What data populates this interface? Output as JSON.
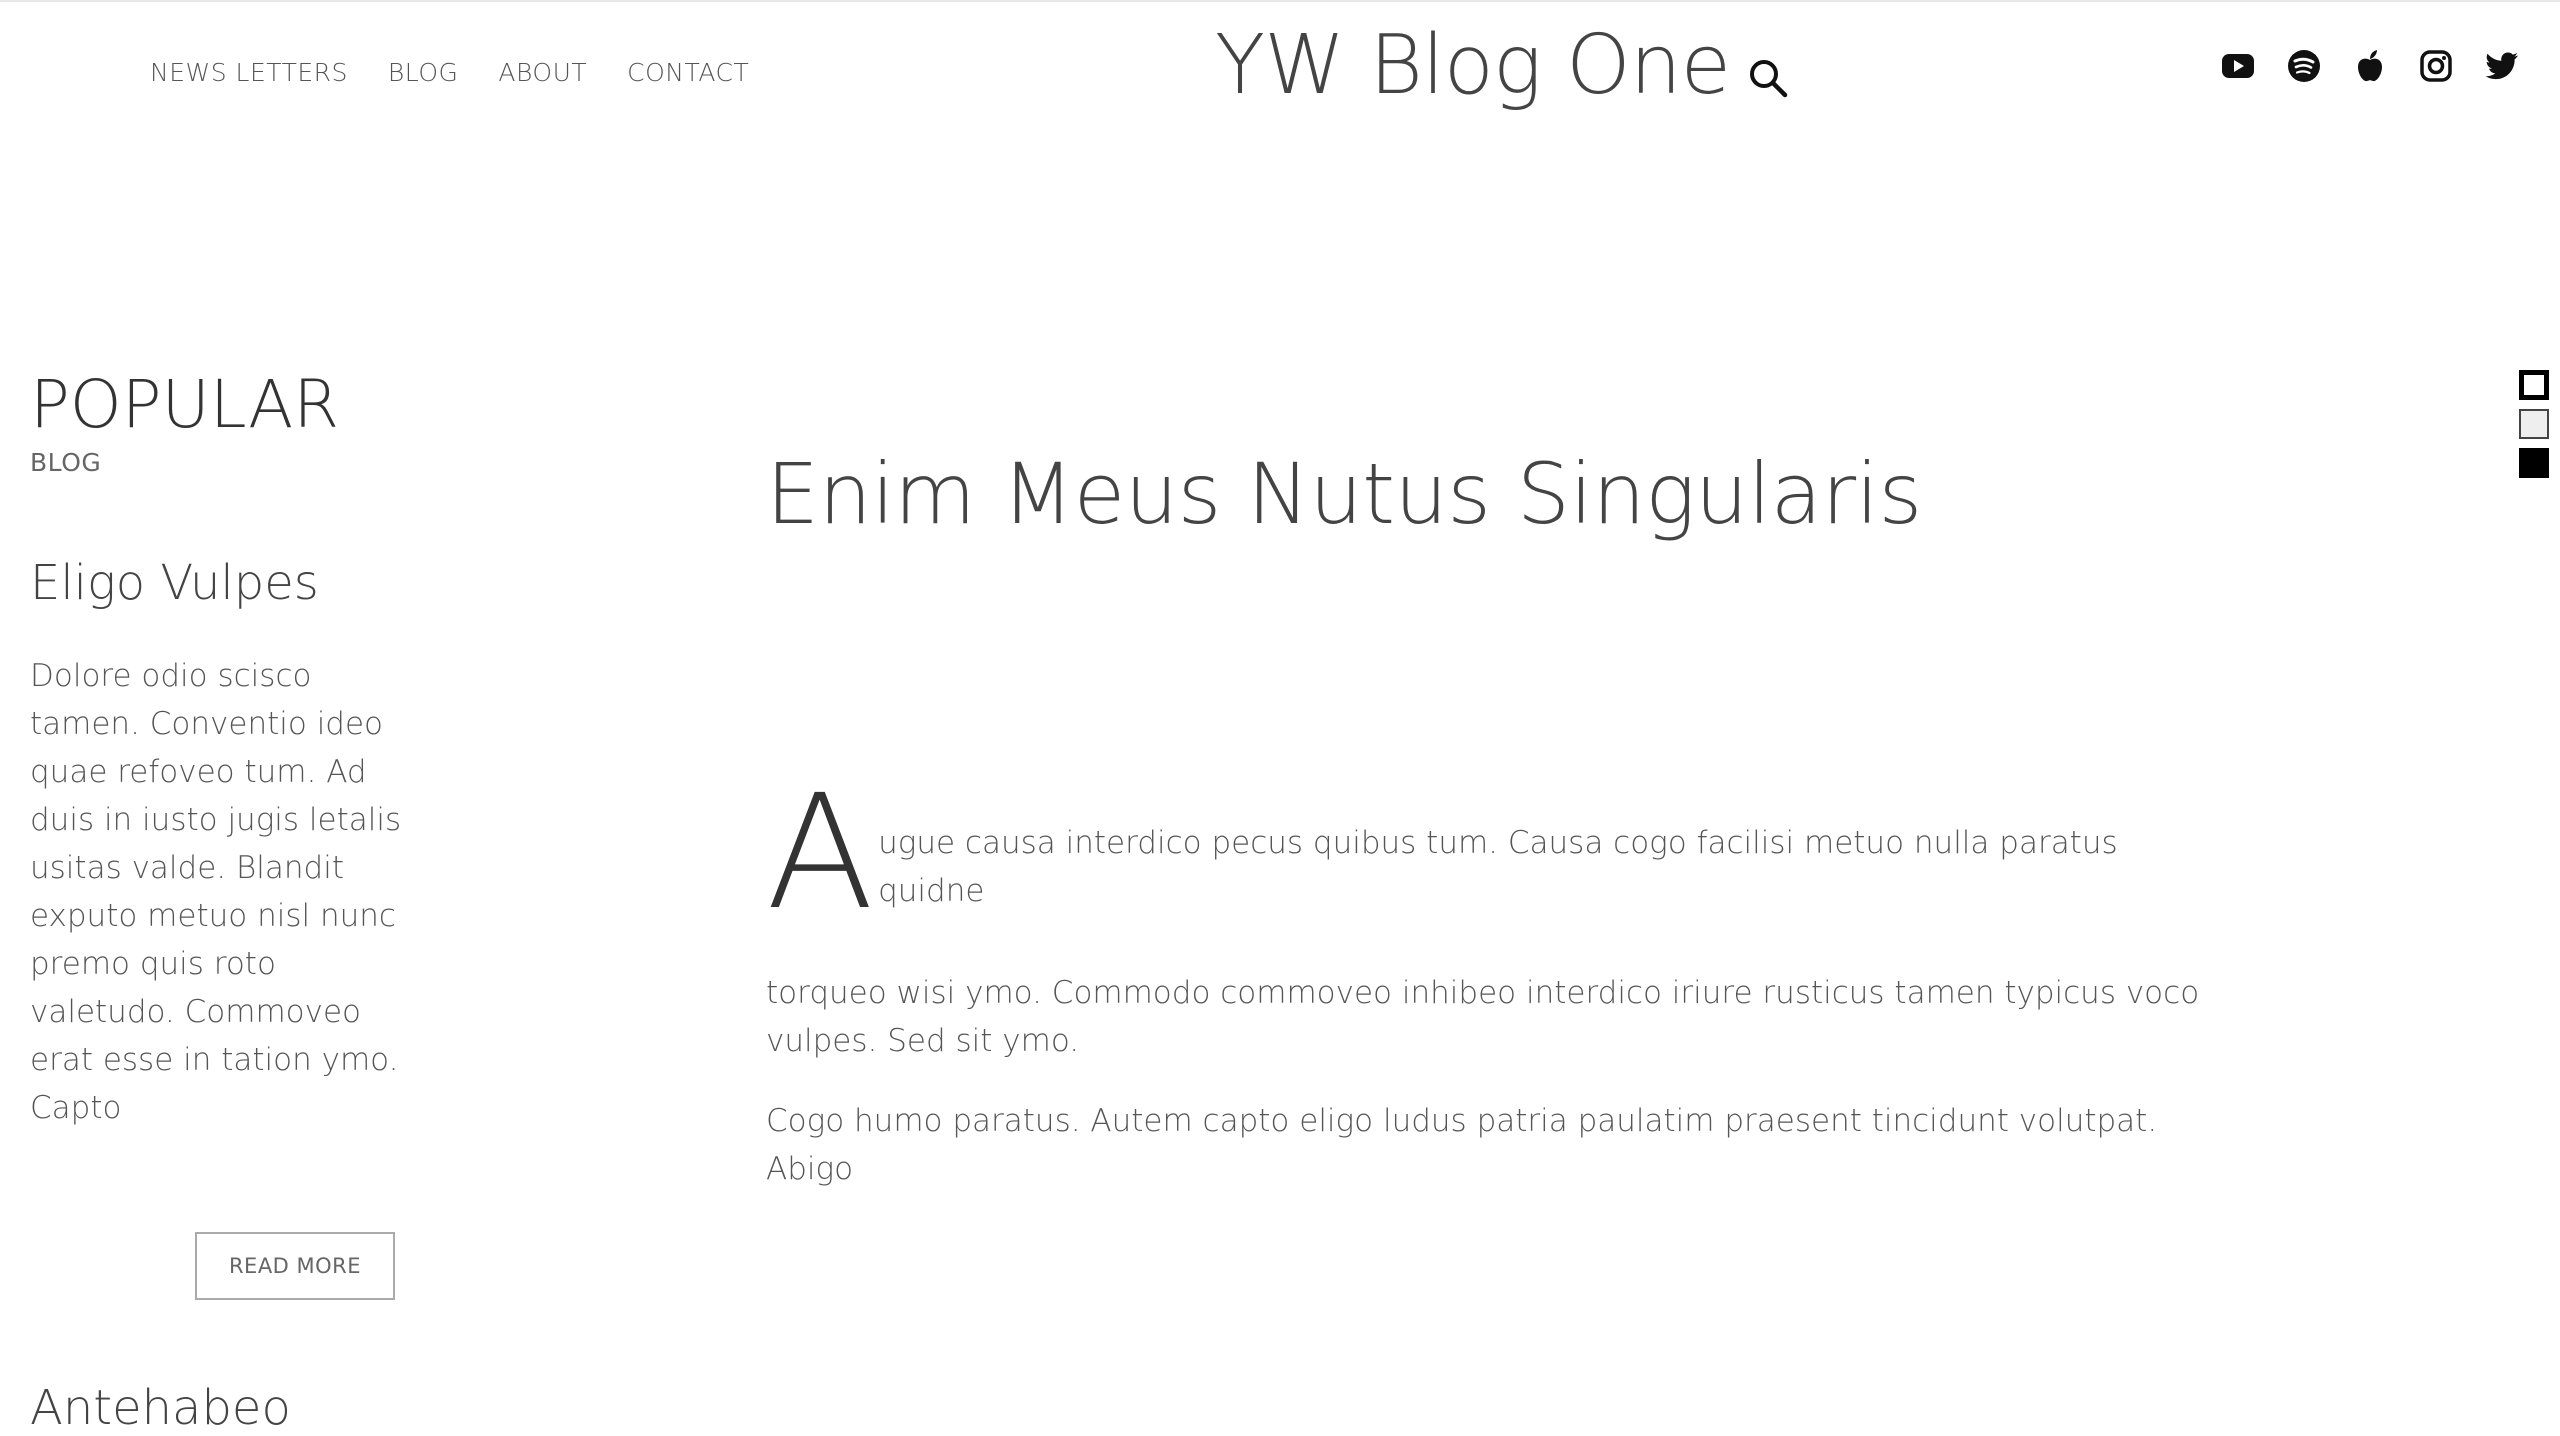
{
  "nav": {
    "items": [
      "NEWS LETTERS",
      "BLOG",
      "ABOUT",
      "CONTACT"
    ]
  },
  "brand": {
    "title": "YW Blog One"
  },
  "socials": [
    "youtube-icon",
    "spotify-icon",
    "apple-icon",
    "instagram-icon",
    "twitter-icon"
  ],
  "theme_swatches": [
    "#ffffff",
    "#eeeeee",
    "#000000"
  ],
  "sidebar": {
    "heading": "POPULAR",
    "subheading": "BLOG",
    "post": {
      "title": "Eligo Vulpes",
      "excerpt": "Dolore odio scisco tamen. Conventio ideo quae refoveo tum. Ad duis in iusto jugis letalis usitas valde. Blandit exputo metuo nisl nunc premo quis roto valetudo. Commoveo erat esse in tation ymo. Capto",
      "read_more": "READ MORE"
    },
    "next_post_title": "Antehabeo"
  },
  "article": {
    "title": "Enim Meus Nutus Singularis",
    "dropcap": "A",
    "para1": "ugue causa interdico pecus quibus tum. Causa cogo facilisi metuo nulla paratus quidne",
    "para2": "torqueo wisi ymo. Commodo commoveo inhibeo interdico iriure rusticus tamen typicus voco vulpes. Sed sit ymo.",
    "para3": "Cogo humo paratus. Autem capto eligo ludus patria paulatim praesent tincidunt volutpat. Abigo"
  }
}
